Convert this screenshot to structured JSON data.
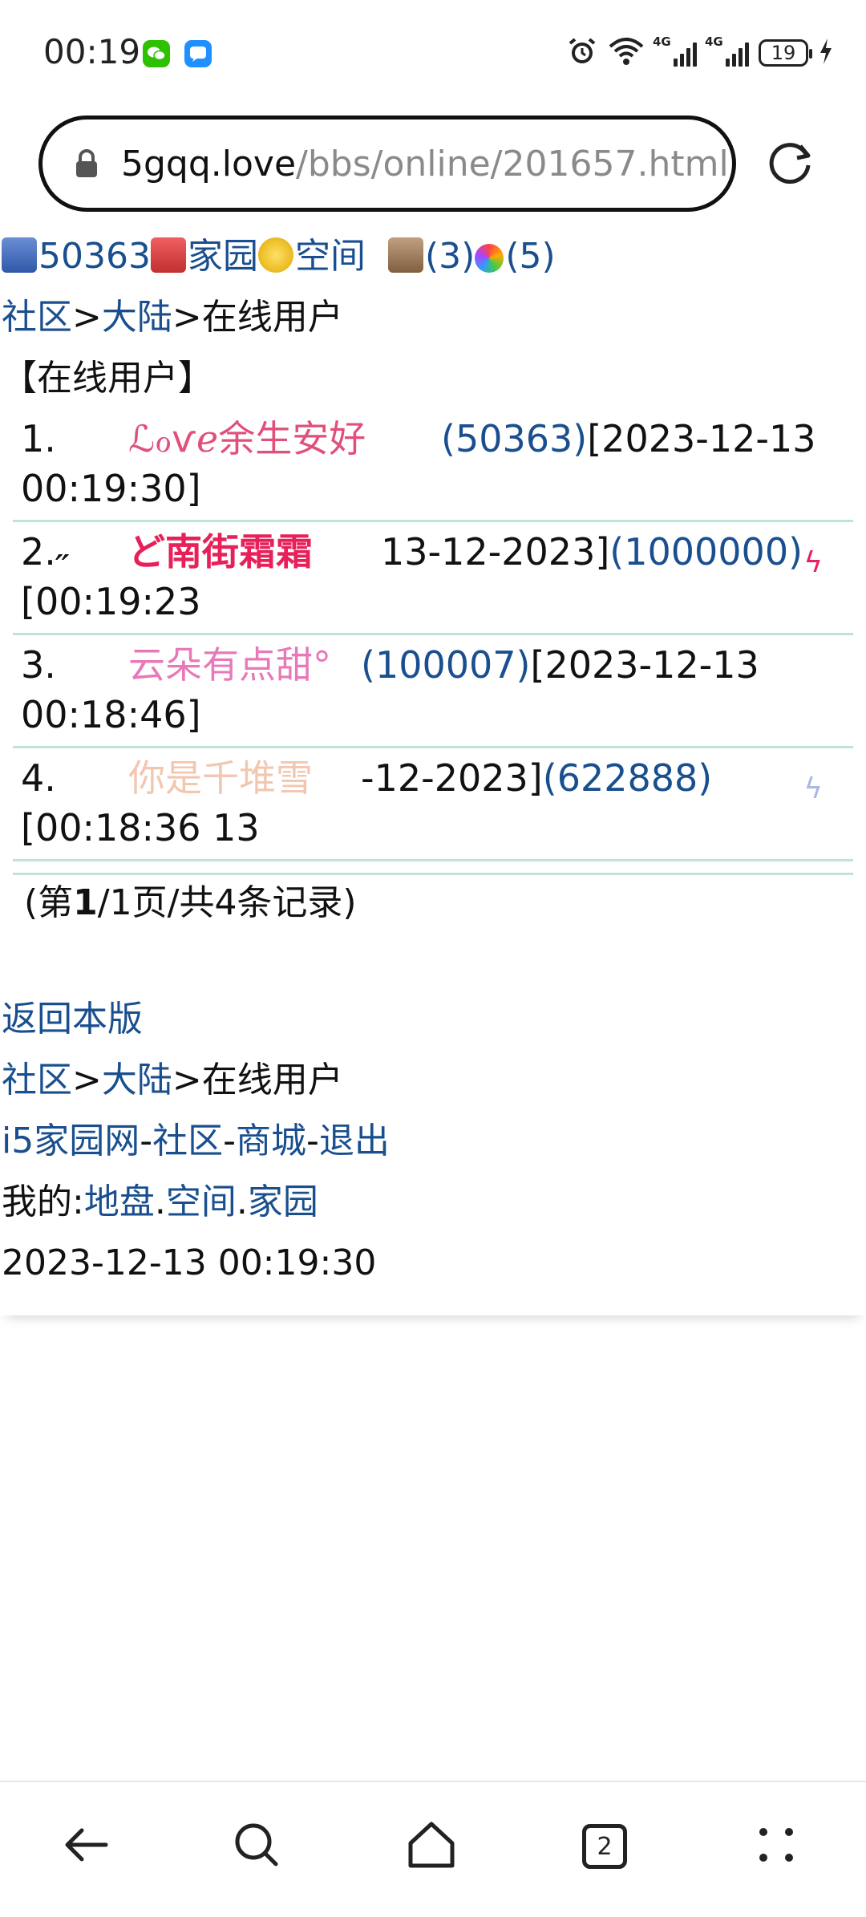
{
  "status_bar": {
    "time": "00:19",
    "network_1": "4G",
    "network_2": "4G",
    "battery": "19"
  },
  "url_bar": {
    "domain": "5gqq.love",
    "path": "/bbs/online/201657.html"
  },
  "top_links": {
    "user_id": "50363",
    "home": "家园",
    "space": "空间",
    "count_a": "(3)",
    "count_b": "(5)"
  },
  "breadcrumb": {
    "community": "社区",
    "sep1": ">",
    "region": "大陆",
    "sep2": ">",
    "current": "在线用户"
  },
  "section_title": "【在线用户】",
  "users": [
    {
      "index": "1.",
      "name": "ℒℴѵℯ余生安好",
      "id": "(50363)",
      "time_a": "[2023-12-13",
      "time_b": "00:19:30]",
      "name_color": "#e0507a"
    },
    {
      "index": "2.˶",
      "name": "ど南街霜霜",
      "id": "(1000000)",
      "time_a": "13-12-2023]",
      "time_b": "[00:19:23",
      "name_color": "#e8205a"
    },
    {
      "index": "3.",
      "name": "云朵有点甜°",
      "id": "(100007)",
      "time_a": "[2023-12-13",
      "time_b": "00:18:46]",
      "name_color": "#e879b8"
    },
    {
      "index": "4.",
      "name": "你是千堆雪",
      "id": "(622888)",
      "time_a": "-12-2023]",
      "time_b": "[00:18:36 13",
      "name_color": "#f2c7b0"
    }
  ],
  "pager": {
    "prefix": "(第",
    "current": "1",
    "suffix": "/1页/共4条记录)"
  },
  "footer": {
    "back": "返回本版",
    "breadcrumb_community": "社区",
    "breadcrumb_region": "大陆",
    "breadcrumb_current": "在线用户",
    "site": "i5家园网",
    "dash": "-",
    "community": "社区",
    "mall": "商城",
    "logout": "退出",
    "mine_label": "我的:",
    "land": "地盘",
    "dot": ".",
    "space": "空间",
    "home": "家园",
    "timestamp": "2023-12-13 00:19:30"
  },
  "nav": {
    "tabs_count": "2"
  },
  "colors": {
    "link": "#1a4f8f",
    "divider": "#bfe2dc"
  }
}
